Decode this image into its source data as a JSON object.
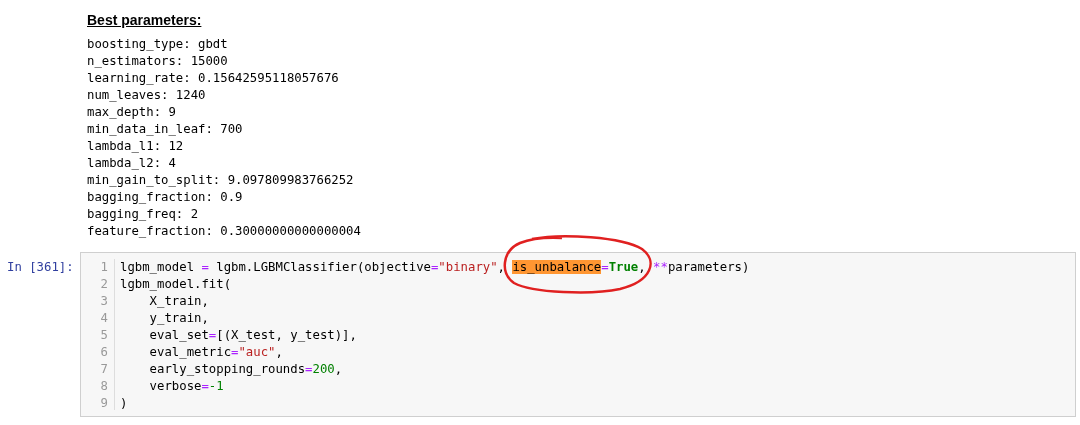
{
  "output": {
    "title": "Best parameters:",
    "lines": [
      "boosting_type: gbdt",
      "n_estimators: 15000",
      "learning_rate: 0.15642595118057676",
      "num_leaves: 1240",
      "max_depth: 9",
      "min_data_in_leaf: 700",
      "lambda_l1: 12",
      "lambda_l2: 4",
      "min_gain_to_split: 9.097809983766252",
      "bagging_fraction: 0.9",
      "bagging_freq: 2",
      "feature_fraction: 0.30000000000000004"
    ]
  },
  "cell": {
    "prompt": "In [361]:",
    "lines": [
      {
        "number": "1",
        "tokens": [
          {
            "kind": "plain",
            "text": "lgbm_model "
          },
          {
            "kind": "op",
            "text": "="
          },
          {
            "kind": "plain",
            "text": " lgbm.LGBMClassifier(objective"
          },
          {
            "kind": "op",
            "text": "="
          },
          {
            "kind": "string",
            "text": "\"binary\""
          },
          {
            "kind": "plain",
            "text": ", "
          },
          {
            "kind": "highlight",
            "text": "is_unbalance"
          },
          {
            "kind": "op",
            "text": "="
          },
          {
            "kind": "keyword",
            "text": "True"
          },
          {
            "kind": "plain",
            "text": ", "
          },
          {
            "kind": "op",
            "text": "**"
          },
          {
            "kind": "plain",
            "text": "parameters)"
          }
        ]
      },
      {
        "number": "2",
        "tokens": [
          {
            "kind": "plain",
            "text": "lgbm_model.fit("
          }
        ]
      },
      {
        "number": "3",
        "tokens": [
          {
            "kind": "plain",
            "text": "    X_train,"
          }
        ]
      },
      {
        "number": "4",
        "tokens": [
          {
            "kind": "plain",
            "text": "    y_train,"
          }
        ]
      },
      {
        "number": "5",
        "tokens": [
          {
            "kind": "plain",
            "text": "    eval_set"
          },
          {
            "kind": "op",
            "text": "="
          },
          {
            "kind": "plain",
            "text": "[(X_test, y_test)],"
          }
        ]
      },
      {
        "number": "6",
        "tokens": [
          {
            "kind": "plain",
            "text": "    eval_metric"
          },
          {
            "kind": "op",
            "text": "="
          },
          {
            "kind": "string",
            "text": "\"auc\""
          },
          {
            "kind": "plain",
            "text": ","
          }
        ]
      },
      {
        "number": "7",
        "tokens": [
          {
            "kind": "plain",
            "text": "    early_stopping_rounds"
          },
          {
            "kind": "op",
            "text": "="
          },
          {
            "kind": "number",
            "text": "200"
          },
          {
            "kind": "plain",
            "text": ","
          }
        ]
      },
      {
        "number": "8",
        "tokens": [
          {
            "kind": "plain",
            "text": "    verbose"
          },
          {
            "kind": "op",
            "text": "="
          },
          {
            "kind": "number",
            "text": "-1"
          }
        ]
      },
      {
        "number": "9",
        "tokens": [
          {
            "kind": "plain",
            "text": ")"
          }
        ]
      }
    ]
  }
}
